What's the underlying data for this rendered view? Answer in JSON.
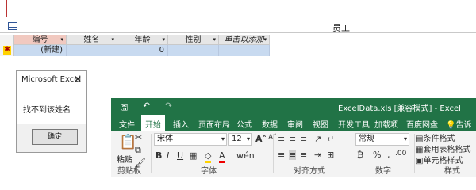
{
  "access": {
    "table_title": "员工",
    "columns": [
      {
        "label": "编号"
      },
      {
        "label": "姓名"
      },
      {
        "label": "年龄"
      },
      {
        "label": "性别"
      },
      {
        "label": "单击以添加"
      }
    ],
    "new_row": {
      "id": "(新建)",
      "age": "0"
    }
  },
  "dialog": {
    "title": "Microsoft Excel",
    "close": "✕",
    "message": "找不到该姓名",
    "ok_label": "确定"
  },
  "excel": {
    "file_title": "ExcelData.xls  [兼容模式] - Excel",
    "quick_access": {
      "save": "🖫",
      "undo": "↶",
      "redo": "↷"
    },
    "menu": [
      "文件",
      "开始",
      "插入",
      "页面布局",
      "公式",
      "数据",
      "审阅",
      "视图",
      "开发工具",
      "加载项",
      "百度网盘",
      "告诉我"
    ],
    "active_menu": "开始",
    "ribbon": {
      "paste_label": "粘贴",
      "font_name": "宋体",
      "font_size": "12",
      "number_format": "常规",
      "cond_format": "条件格式",
      "table_format": "套用表格格式",
      "cell_style": "单元格样式",
      "groups": [
        "剪贴板",
        "字体",
        "对齐方式",
        "数字",
        "样式"
      ]
    }
  }
}
